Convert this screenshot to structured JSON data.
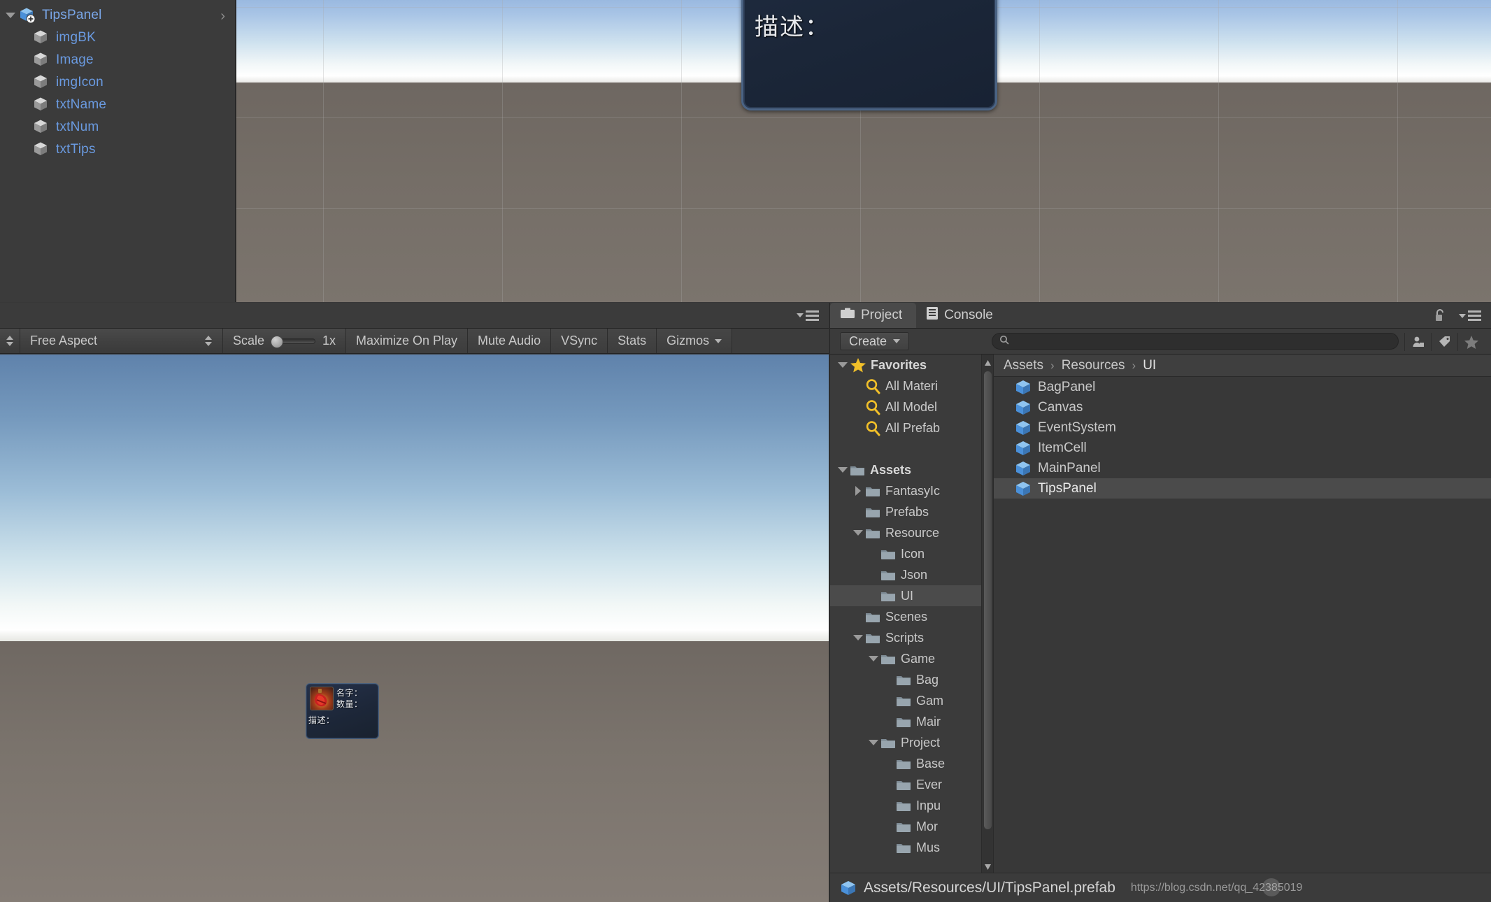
{
  "hierarchy": {
    "root": {
      "label": "TipsPanel",
      "icon": "prefab-cube-icon",
      "chevron": "›"
    },
    "children": [
      {
        "label": "imgBK",
        "icon": "gameobject-cube-icon"
      },
      {
        "label": "Image",
        "icon": "gameobject-cube-icon"
      },
      {
        "label": "imgIcon",
        "icon": "gameobject-cube-icon"
      },
      {
        "label": "txtName",
        "icon": "gameobject-cube-icon"
      },
      {
        "label": "txtNum",
        "icon": "gameobject-cube-icon"
      },
      {
        "label": "txtTips",
        "icon": "gameobject-cube-icon"
      }
    ]
  },
  "scene_view": {
    "tips_preview": {
      "description_label": "描述："
    }
  },
  "game_panel": {
    "toolbar": {
      "aspect": "Free Aspect",
      "scale_label": "Scale",
      "scale_value": "1x",
      "maximize_on_play": "Maximize On Play",
      "mute_audio": "Mute Audio",
      "vsync": "VSync",
      "stats": "Stats",
      "gizmos": "Gizmos"
    },
    "tips_panel": {
      "name_label": "名字：",
      "num_label": "数量：",
      "desc_label": "描述：",
      "icon": "red-potion-icon"
    }
  },
  "project_panel": {
    "tabs": [
      {
        "label": "Project",
        "icon": "project-folder-icon",
        "active": true
      },
      {
        "label": "Console",
        "icon": "console-log-icon",
        "active": false
      }
    ],
    "lock_icon": "lock-open-icon",
    "menu_icon": "panel-menu-icon",
    "toolbar": {
      "create_label": "Create",
      "create_caret": "chevron-down-icon",
      "search_placeholder": "",
      "search_value": "",
      "icons": [
        "asset-type-filter-icon",
        "label-filter-icon",
        "favorite-star-icon"
      ]
    },
    "tree": [
      {
        "label": "Favorites",
        "icon": "star-icon",
        "twisty": "down",
        "indent": 0,
        "bold": true
      },
      {
        "label": "All Materi",
        "icon": "magnifier-icon",
        "twisty": "none",
        "indent": 1,
        "bold": false
      },
      {
        "label": "All Model",
        "icon": "magnifier-icon",
        "twisty": "none",
        "indent": 1,
        "bold": false
      },
      {
        "label": "All Prefab",
        "icon": "magnifier-icon",
        "twisty": "none",
        "indent": 1,
        "bold": false
      },
      {
        "label": "",
        "icon": "none",
        "twisty": "none",
        "indent": 0,
        "bold": false
      },
      {
        "label": "Assets",
        "icon": "folder-icon",
        "twisty": "down",
        "indent": 0,
        "bold": true
      },
      {
        "label": "FantasyIc",
        "icon": "folder-icon",
        "twisty": "right",
        "indent": 1,
        "bold": false
      },
      {
        "label": "Prefabs",
        "icon": "folder-icon",
        "twisty": "none",
        "indent": 1,
        "bold": false
      },
      {
        "label": "Resource",
        "icon": "folder-icon",
        "twisty": "down",
        "indent": 1,
        "bold": false
      },
      {
        "label": "Icon",
        "icon": "folder-icon",
        "twisty": "none",
        "indent": 2,
        "bold": false
      },
      {
        "label": "Json",
        "icon": "folder-icon",
        "twisty": "none",
        "indent": 2,
        "bold": false
      },
      {
        "label": "UI",
        "icon": "folder-icon",
        "twisty": "none",
        "indent": 2,
        "bold": false,
        "selected": true
      },
      {
        "label": "Scenes",
        "icon": "folder-icon",
        "twisty": "none",
        "indent": 1,
        "bold": false
      },
      {
        "label": "Scripts",
        "icon": "folder-icon",
        "twisty": "down",
        "indent": 1,
        "bold": false
      },
      {
        "label": "Game",
        "icon": "folder-icon",
        "twisty": "down",
        "indent": 2,
        "bold": false
      },
      {
        "label": "Bag",
        "icon": "folder-icon",
        "twisty": "none",
        "indent": 3,
        "bold": false
      },
      {
        "label": "Gam",
        "icon": "folder-icon",
        "twisty": "none",
        "indent": 3,
        "bold": false
      },
      {
        "label": "Mair",
        "icon": "folder-icon",
        "twisty": "none",
        "indent": 3,
        "bold": false
      },
      {
        "label": "Project",
        "icon": "folder-icon",
        "twisty": "down",
        "indent": 2,
        "bold": false
      },
      {
        "label": "Base",
        "icon": "folder-icon",
        "twisty": "none",
        "indent": 3,
        "bold": false
      },
      {
        "label": "Ever",
        "icon": "folder-icon",
        "twisty": "none",
        "indent": 3,
        "bold": false
      },
      {
        "label": "Inpu",
        "icon": "folder-icon",
        "twisty": "none",
        "indent": 3,
        "bold": false
      },
      {
        "label": "Mor",
        "icon": "folder-icon",
        "twisty": "none",
        "indent": 3,
        "bold": false
      },
      {
        "label": "Mus",
        "icon": "folder-icon",
        "twisty": "none",
        "indent": 3,
        "bold": false
      }
    ],
    "breadcrumb": [
      "Assets",
      "Resources",
      "UI"
    ],
    "breadcrumb_separator": "›",
    "assets": [
      {
        "label": "BagPanel",
        "icon": "prefab-cube-icon",
        "selected": false
      },
      {
        "label": "Canvas",
        "icon": "prefab-cube-icon",
        "selected": false
      },
      {
        "label": "EventSystem",
        "icon": "prefab-cube-icon",
        "selected": false
      },
      {
        "label": "ItemCell",
        "icon": "prefab-cube-icon",
        "selected": false
      },
      {
        "label": "MainPanel",
        "icon": "prefab-cube-icon",
        "selected": false
      },
      {
        "label": "TipsPanel",
        "icon": "prefab-cube-icon",
        "selected": true
      }
    ],
    "status": {
      "icon": "prefab-cube-icon",
      "path": "Assets/Resources/UI/TipsPanel.prefab",
      "watermark": "https://blog.csdn.net/qq_42385019"
    }
  },
  "colors": {
    "panel_bg": "#383838",
    "panel_bg_light": "#3b3b3b",
    "selection": "#4b4b4b",
    "hierarchy_text": "#6a9ae0",
    "text": "#c9c9c9",
    "favorite_yellow": "#f2c029",
    "prefab_blue": "#4a90d9"
  }
}
